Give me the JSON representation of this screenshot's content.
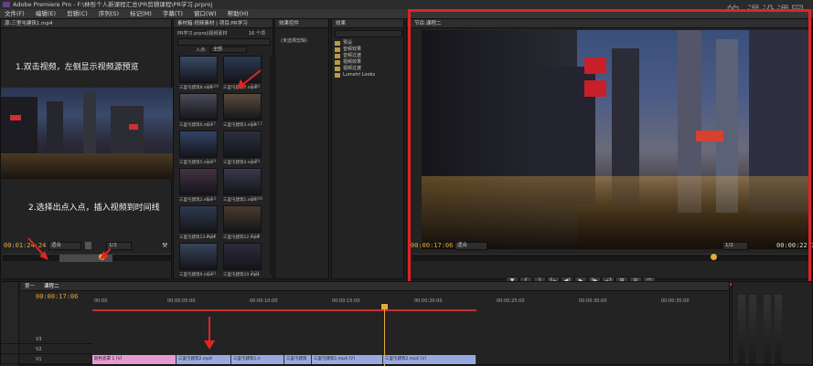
{
  "window": {
    "title": "Adobe Premiere Pro - F:\\林彤个人新课程汇总\\PR剪辑课程\\PR学习.prproj",
    "watermark": "的 漫设课网"
  },
  "menu": [
    "文件(F)",
    "编辑(E)",
    "剪辑(C)",
    "序列(S)",
    "标记(M)",
    "字幕(T)",
    "窗口(W)",
    "帮助(H)"
  ],
  "source_monitor": {
    "tab": "源:三里屯建筑1.mp4",
    "note1": "1.双击视频，左侧显示视频源预览",
    "note2": "2.选择出点入点，插入视频到时间线",
    "timecode": "00:01:24:24",
    "fit": "适合",
    "zoom": "1/2",
    "buttons": [
      "{",
      "}",
      "{←",
      "◀|",
      "▶",
      "|▶",
      "→}",
      "⊞",
      "⊟",
      "◫"
    ]
  },
  "project_panel": {
    "tabs": [
      "素材箱:视频素材",
      "项目:PR学习"
    ],
    "path": "PR学习.prproj\\视频素材",
    "count": "16 个项",
    "inpoint_label": "入点:",
    "inpoint_value": "全部",
    "items": [
      {
        "name": "三里屯建筑8.mp4",
        "dur": "14:29"
      },
      {
        "name": "三里屯建筑7.mp4",
        "dur": "7:00"
      },
      {
        "name": "三里屯建筑6.mp4",
        "dur": "4:17"
      },
      {
        "name": "三里屯建筑3.mp4",
        "dur": "11:17"
      },
      {
        "name": "三里屯建筑5.mp4",
        "dur": "5:19"
      },
      {
        "name": "三里屯建筑4.mp4",
        "dur": "3:29"
      },
      {
        "name": "三里屯建筑2.mp4",
        "dur": "6:14"
      },
      {
        "name": "三里屯建筑1.mp4",
        "dur": "10:09"
      },
      {
        "name": "三里屯建筑13.mp4",
        "dur": "8:24"
      },
      {
        "name": "三里屯建筑12.mp4",
        "dur": "5:19"
      },
      {
        "name": "三里屯建筑9.mp4",
        "dur": "4:10"
      },
      {
        "name": "三里屯建筑10.mp4",
        "dur": "7:21"
      }
    ]
  },
  "effect_controls": {
    "tab": "效果控件",
    "empty": "(未选择剪辑)"
  },
  "effects_panel": {
    "tab": "效果",
    "items": [
      "预设",
      "音频效果",
      "音频过渡",
      "视频效果",
      "视频过渡",
      "Lumetri Looks"
    ]
  },
  "program_monitor": {
    "tab": "节目:课程二",
    "timecode": "00:00:17:06",
    "fit": "适合",
    "zoom": "1/2",
    "duration": "00:00:22:16",
    "buttons": [
      "▼",
      "{",
      "}",
      "{←",
      "◀|",
      "▶",
      "|▶",
      "→}",
      "⊞",
      "⊟",
      "◫"
    ]
  },
  "timeline": {
    "tabs": [
      "第一",
      "课程二"
    ],
    "timecode": "00:00:17:06",
    "ruler": [
      "00:00",
      "00:00:05:00",
      "00:00:10:00",
      "00:00:15:00",
      "00:00:20:00",
      "00:00:25:00",
      "00:00:30:00",
      "00:00:35:00"
    ],
    "tracks": [
      "V3",
      "V2",
      "V1"
    ],
    "clips": [
      {
        "label": "颜色遮罩 1 [V]",
        "color": "#e79ad0"
      },
      {
        "label": "三里屯建筑2.mp4",
        "color": "#9aa8e0"
      },
      {
        "label": "三里屯建筑1.n",
        "color": "#9aa8e0"
      },
      {
        "label": "三里屯建筑",
        "color": "#9aa8e0"
      },
      {
        "label": "三里屯建筑1.mp4 [V]",
        "color": "#9aa8e0"
      },
      {
        "label": "三里屯建筑2.mp4 [V]",
        "color": "#9aa8e0"
      }
    ]
  },
  "colors": {
    "accent_red": "#e02424",
    "timecode": "#e8a93a"
  }
}
